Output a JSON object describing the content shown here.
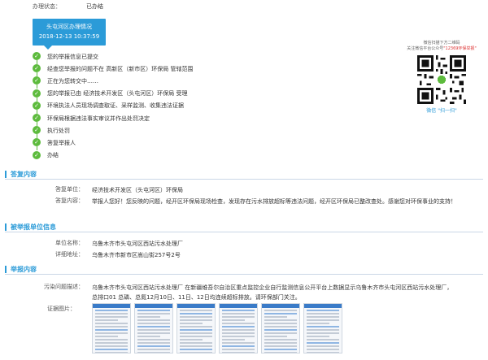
{
  "status": {
    "label": "办理状态：",
    "value": "已办结"
  },
  "progress_header": {
    "title": "头屯河区办理情况",
    "time": "2018-12-13 10:37:59"
  },
  "steps": [
    {
      "text": "您的举报信息已提交"
    },
    {
      "text": "经查您举报的问题不在 高新区（新市区）环保局 管辖范围"
    },
    {
      "text": "正在为您转交中……"
    },
    {
      "text": "您的举报已由 经济技术开发区（头屯河区）环保局 受理"
    },
    {
      "text": "环境执法人员现场调查取证、采样监测、收集违法证据"
    },
    {
      "text": "环保局根据违法事实审议并作出处罚决定"
    },
    {
      "text": "执行处罚"
    },
    {
      "text": "答复举报人"
    },
    {
      "text": "办结"
    }
  ],
  "qr": {
    "caption1": "微信扫描下方二维码",
    "caption2_pre": "关注微信平台公众号",
    "caption2_highlight": "\"12369环保举报\"",
    "foot": "微信 \"扫一扫\""
  },
  "reply_section": {
    "title": "答复内容",
    "unit_label": "答复单位：",
    "unit_value": "经济技术开发区（头屯河区）环保局",
    "content_label": "答复内容：",
    "content_value": "举报人您好！您反映的问题，经开区环保局现场检查，发现存在污水排放超标等违法问题，经开区环保局已整改查处。感谢您对环保事业的支持！"
  },
  "reported_section": {
    "title": "被举报单位信息",
    "name_label": "单位名称：",
    "name_value": "乌鲁木齐市头屯河区西站污水处理厂",
    "addr_label": "详细地址：",
    "addr_value": "乌鲁木齐市新市区嵩山街257号2号"
  },
  "report_section": {
    "title": "举报内容",
    "desc_label": "污染问题描述：",
    "desc_value": "乌鲁木齐市头屯河区西站污水处理厂 在新疆维吾尔自治区重点监控企业自行监测信息公开平台上数据显示乌鲁木齐市头屯河区西站污水处理厂，总排口01 总磷、总氮12月10日、11日、12日均连续超标排放。请环保部门关注。",
    "evidence_label": "证据图片："
  },
  "colors": {
    "accent": "#2b9bd8",
    "check": "#5dbb3d"
  },
  "icons": {
    "step": "check-circle-icon",
    "qr": "qr-code-icon"
  }
}
